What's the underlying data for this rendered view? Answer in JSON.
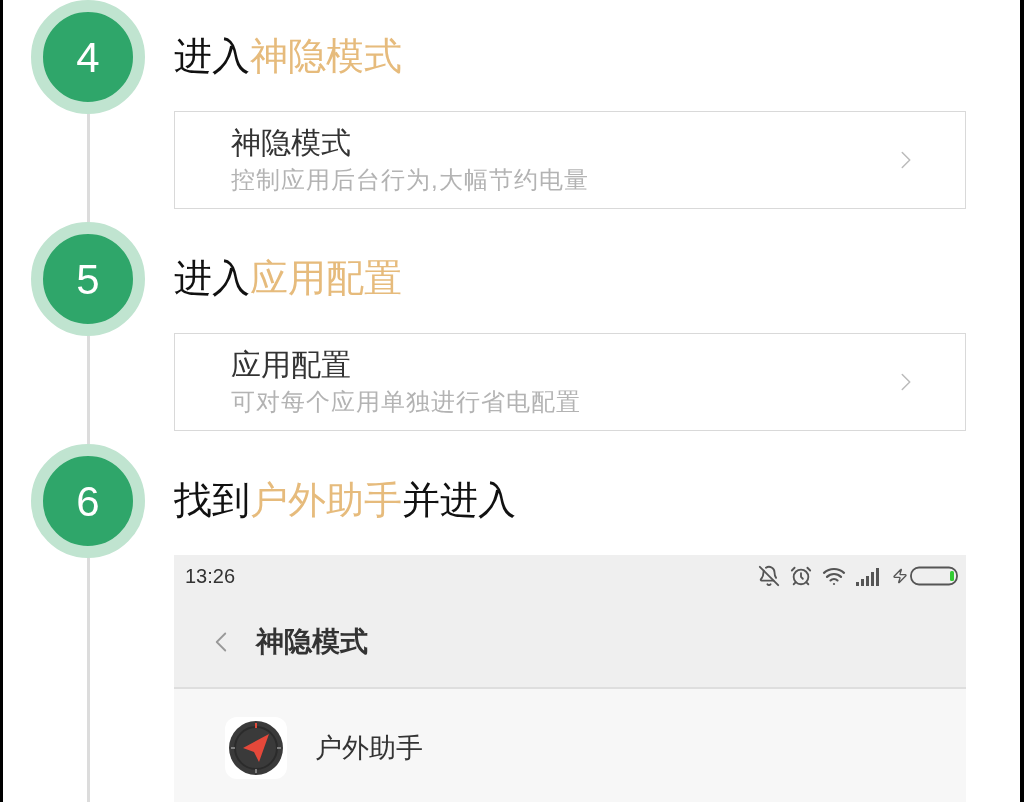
{
  "steps": [
    {
      "number": "4",
      "title": [
        {
          "text": "进入",
          "highlighted": false
        },
        {
          "text": "神隐模式",
          "highlighted": true
        }
      ],
      "content": {
        "kind": "setting",
        "title": "神隐模式",
        "subtitle": "控制应用后台行为,大幅节约电量"
      }
    },
    {
      "number": "5",
      "title": [
        {
          "text": "进入",
          "highlighted": false
        },
        {
          "text": "应用配置",
          "highlighted": true
        }
      ],
      "content": {
        "kind": "setting",
        "title": "应用配置",
        "subtitle": "可对每个应用单独进行省电配置"
      }
    },
    {
      "number": "6",
      "title": [
        {
          "text": "找到",
          "highlighted": false
        },
        {
          "text": "户外助手",
          "highlighted": true
        },
        {
          "text": "并进入",
          "highlighted": false
        }
      ],
      "content": {
        "kind": "screenshot",
        "status_bar": {
          "time": "13:26"
        },
        "header": {
          "title": "神隐模式"
        },
        "apps": [
          {
            "name": "户外助手"
          }
        ]
      }
    }
  ]
}
